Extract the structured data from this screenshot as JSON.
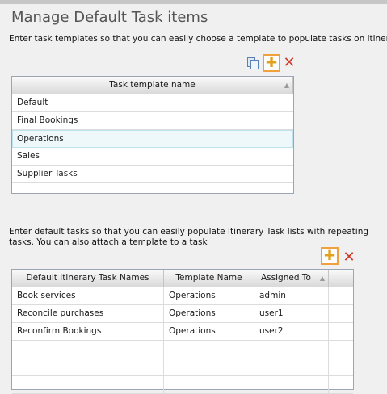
{
  "page": {
    "title": "Manage Default Task items"
  },
  "templates": {
    "description": "Enter task templates so that you can easily choose a template to populate tasks on itinerary.",
    "toolbar": {
      "copy_icon": "copy-icon",
      "add_icon": "add-icon",
      "delete_icon": "delete-icon"
    },
    "header": "Task template name",
    "rows": [
      "Default",
      "Final Bookings",
      "Operations",
      "Sales",
      "Supplier Tasks"
    ],
    "selected_row": "Operations"
  },
  "tasks": {
    "description": "Enter default tasks so that you can easily populate Itinerary Task lists with repeating tasks. You can also attach a template to a task",
    "toolbar": {
      "add_icon": "add-icon",
      "delete_icon": "delete-icon"
    },
    "headers": [
      "Default Itinerary Task Names",
      "Template Name",
      "Assigned To"
    ],
    "rows": [
      [
        "Book services",
        "Operations",
        "admin"
      ],
      [
        "Reconcile purchases",
        "Operations",
        "user1"
      ],
      [
        "Reconfirm Bookings",
        "Operations",
        "user2"
      ]
    ]
  },
  "colors": {
    "highlight": "#f0a03c",
    "add": "#e0a21a",
    "delete": "#d23a2a",
    "selected_row": "#eef8fb"
  }
}
